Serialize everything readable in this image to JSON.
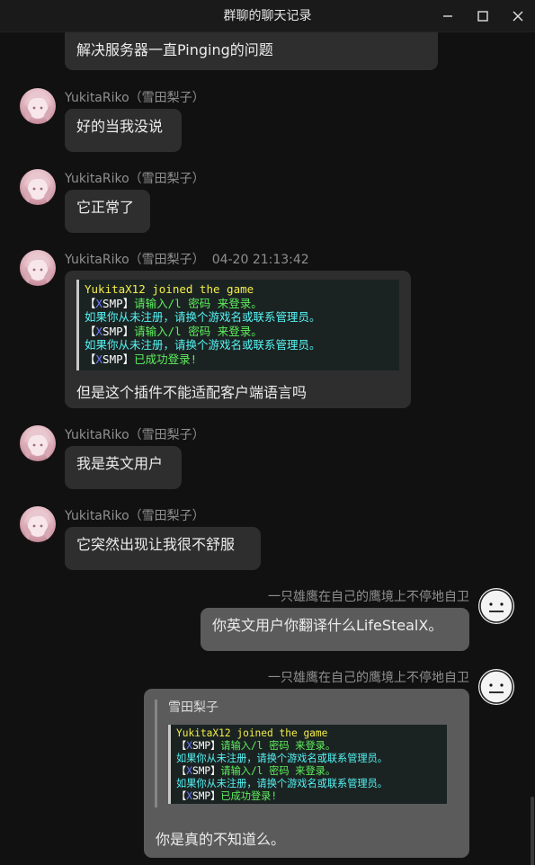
{
  "window": {
    "title": "群聊的聊天记录",
    "controls": [
      "minimize-icon",
      "maximize-icon",
      "close-icon"
    ]
  },
  "messages": [
    {
      "id": 1,
      "partial": true,
      "text": "解决服务器一直Pinging的问题"
    },
    {
      "id": 2,
      "sender": "YukitaRiko（雪田梨子）",
      "text": "好的当我没说"
    },
    {
      "id": 3,
      "sender": "YukitaRiko（雪田梨子）",
      "text": "它正常了"
    },
    {
      "id": 4,
      "sender": "YukitaRiko（雪田梨子）",
      "time": "04-20 21:13:42",
      "text": "但是这个插件不能适配客户端语言吗",
      "log": {
        "l1": "YukitaX12 joined the game",
        "bracket_open": "【",
        "x": "X",
        "smp": "SMP",
        "bracket_close": "】",
        "prompt": "请输入/l 密码 来登录。",
        "notice": "如果你从未注册，请换个游戏名或联系管理员。",
        "success": "已成功登录!"
      }
    },
    {
      "id": 5,
      "sender": "YukitaRiko（雪田梨子）",
      "text": "我是英文用户"
    },
    {
      "id": 6,
      "sender": "YukitaRiko（雪田梨子）",
      "text": "它突然出现让我很不舒服"
    },
    {
      "id": 7,
      "sender": "一只雄鹰在自己的鹰境上不停地自卫",
      "text": "你英文用户你翻译什么LifeStealX。"
    },
    {
      "id": 8,
      "sender": "一只雄鹰在自己的鹰境上不停地自卫",
      "quote_name": "雪田梨子",
      "text": "你是真的不知道么。"
    }
  ],
  "colors": {
    "background": "#111111",
    "bubble_other": "#2e2e2e",
    "bubble_self": "#5b5b5b",
    "sender_name": "#8f8f8f"
  }
}
